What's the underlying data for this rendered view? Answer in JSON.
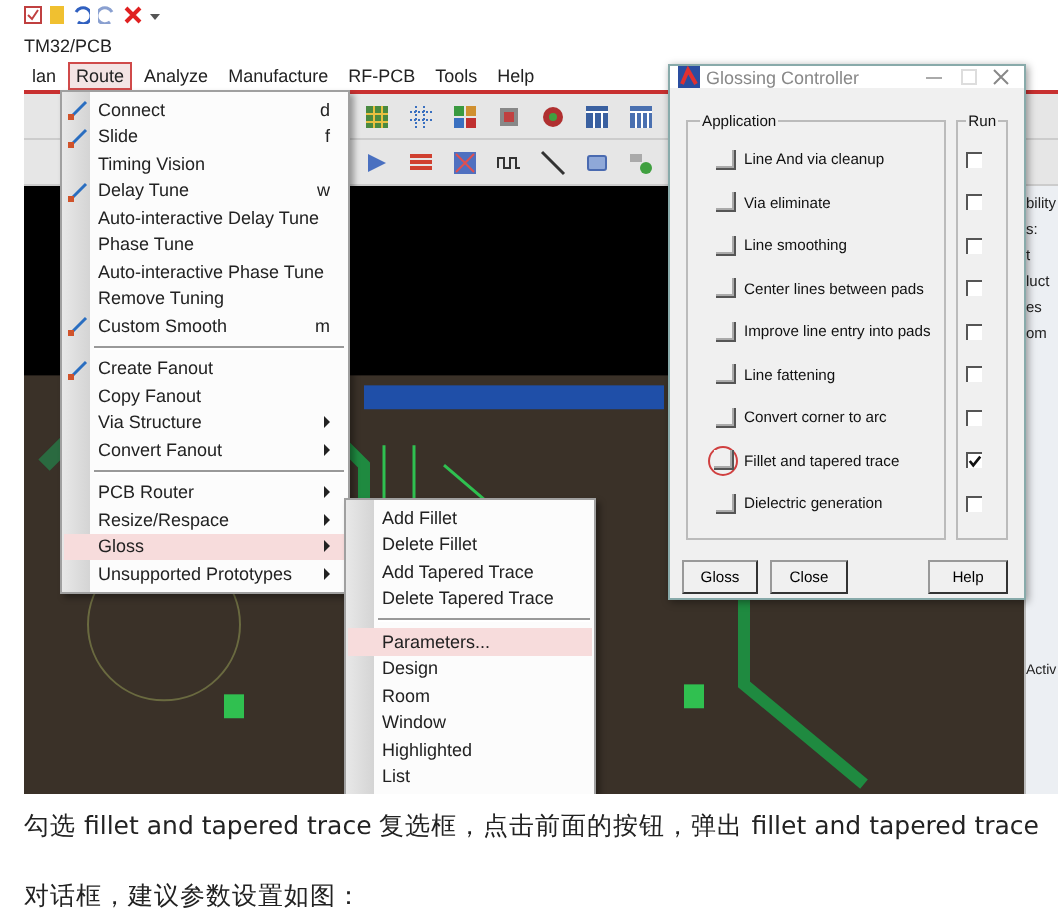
{
  "window": {
    "title": "TM32/PCB"
  },
  "menu_bar": [
    {
      "label": "lan",
      "selected": false
    },
    {
      "label": "Route",
      "selected": true
    },
    {
      "label": "Analyze",
      "selected": false
    },
    {
      "label": "Manufacture",
      "selected": false
    },
    {
      "label": "RF-PCB",
      "selected": false
    },
    {
      "label": "Tools",
      "selected": false
    },
    {
      "label": "Help",
      "selected": false
    }
  ],
  "route_menu": {
    "groups": [
      {
        "items": [
          {
            "label": "Connect",
            "shortcut": "d",
            "icon": true,
            "submenu": false,
            "selected": false
          },
          {
            "label": "Slide",
            "shortcut": "f",
            "icon": true,
            "submenu": false,
            "selected": false
          },
          {
            "label": "Timing Vision",
            "icon": false,
            "submenu": false,
            "selected": false
          },
          {
            "label": "Delay Tune",
            "shortcut": "w",
            "icon": true,
            "submenu": false,
            "selected": false
          },
          {
            "label": "Auto-interactive Delay Tune",
            "icon": false,
            "submenu": false,
            "selected": false
          },
          {
            "label": "Phase Tune",
            "icon": false,
            "submenu": false,
            "selected": false
          },
          {
            "label": "Auto-interactive Phase Tune",
            "icon": false,
            "submenu": false,
            "selected": false
          },
          {
            "label": "Remove Tuning",
            "icon": false,
            "submenu": false,
            "selected": false
          },
          {
            "label": "Custom Smooth",
            "shortcut": "m",
            "icon": true,
            "submenu": false,
            "selected": false
          }
        ]
      },
      {
        "items": [
          {
            "label": "Create Fanout",
            "icon": true,
            "submenu": false,
            "selected": false
          },
          {
            "label": "Copy Fanout",
            "icon": false,
            "submenu": false,
            "selected": false
          },
          {
            "label": "Via Structure",
            "icon": false,
            "submenu": true,
            "selected": false
          },
          {
            "label": "Convert Fanout",
            "icon": false,
            "submenu": true,
            "selected": false
          }
        ]
      },
      {
        "items": [
          {
            "label": "PCB Router",
            "icon": false,
            "submenu": true,
            "selected": false
          },
          {
            "label": "Resize/Respace",
            "icon": false,
            "submenu": true,
            "selected": false
          },
          {
            "label": "Gloss",
            "icon": false,
            "submenu": true,
            "selected": true
          },
          {
            "label": "Unsupported Prototypes",
            "icon": false,
            "submenu": true,
            "selected": false
          }
        ]
      }
    ]
  },
  "gloss_menu": {
    "groups": [
      {
        "items": [
          {
            "label": "Add Fillet",
            "icon": false,
            "submenu": false,
            "selected": false
          },
          {
            "label": "Delete Fillet",
            "icon": false,
            "submenu": false,
            "selected": false
          },
          {
            "label": "Add Tapered Trace",
            "icon": false,
            "submenu": false,
            "selected": false
          },
          {
            "label": "Delete Tapered Trace",
            "icon": false,
            "submenu": false,
            "selected": false
          }
        ]
      },
      {
        "items": [
          {
            "label": "Parameters...",
            "icon": false,
            "submenu": false,
            "selected": true
          },
          {
            "label": "Design",
            "icon": false,
            "submenu": false,
            "selected": false
          },
          {
            "label": "Room",
            "icon": false,
            "submenu": false,
            "selected": false
          },
          {
            "label": "Window",
            "icon": false,
            "submenu": false,
            "selected": false
          },
          {
            "label": "Highlighted",
            "icon": false,
            "submenu": false,
            "selected": false
          },
          {
            "label": "List",
            "icon": false,
            "submenu": false,
            "selected": false
          }
        ]
      }
    ]
  },
  "side_panel": {
    "texts": [
      "bility",
      "s:",
      "t",
      "luct",
      "es",
      "om"
    ],
    "field_label": "Activ"
  },
  "dialog": {
    "title": "Glossing Controller",
    "application_label": "Application",
    "run_label": "Run",
    "rows": [
      {
        "label": "Line And via cleanup",
        "checked": false,
        "circled": false
      },
      {
        "label": "Via eliminate",
        "checked": false,
        "circled": false
      },
      {
        "label": "Line smoothing",
        "checked": false,
        "circled": false
      },
      {
        "label": "Center lines between pads",
        "checked": false,
        "circled": false
      },
      {
        "label": "Improve line entry into pads",
        "checked": false,
        "circled": false
      },
      {
        "label": "Line fattening",
        "checked": false,
        "circled": false
      },
      {
        "label": "Convert corner to arc",
        "checked": false,
        "circled": false
      },
      {
        "label": "Fillet and tapered trace",
        "checked": true,
        "circled": true
      },
      {
        "label": "Dielectric generation",
        "checked": false,
        "circled": false
      }
    ],
    "buttons": [
      "Gloss",
      "Close",
      "Help"
    ]
  },
  "article": {
    "paragraphs": [
      "勾选 fillet and tapered trace 复选框，点击前面的按钮，弹出 fillet and tapered trace",
      "对话框，建议参数设置如图："
    ]
  }
}
